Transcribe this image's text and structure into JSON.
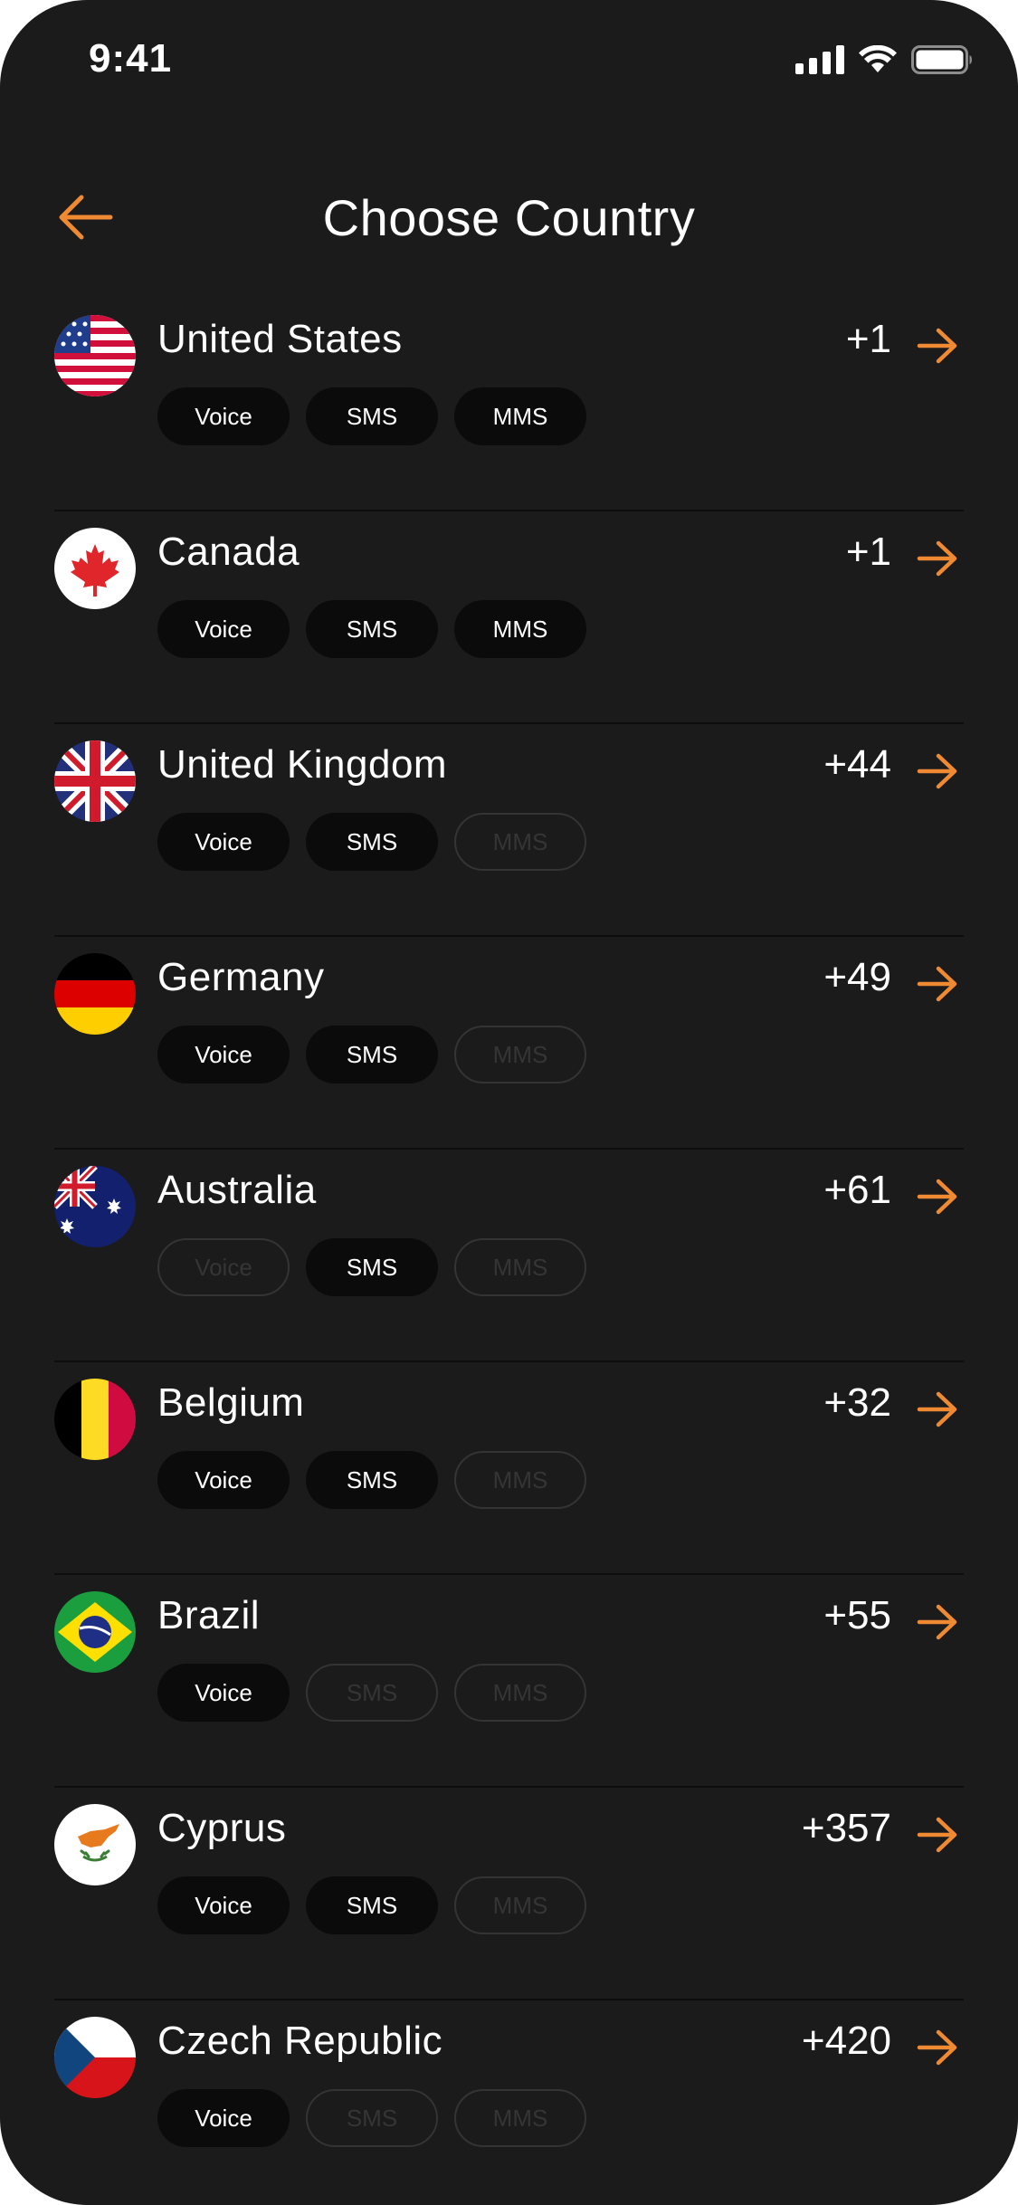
{
  "status": {
    "time": "9:41"
  },
  "header": {
    "title": "Choose Country"
  },
  "colors": {
    "accent": "#f08a32",
    "background": "#1b1b1c",
    "chip_on": "#0b0b0b"
  },
  "countries": [
    {
      "name": "United States",
      "code": "+1",
      "flag": "us-flag-icon",
      "services": [
        {
          "label": "Voice",
          "available": true
        },
        {
          "label": "SMS",
          "available": true
        },
        {
          "label": "MMS",
          "available": true
        }
      ]
    },
    {
      "name": "Canada",
      "code": "+1",
      "flag": "canada-flag-icon",
      "services": [
        {
          "label": "Voice",
          "available": true
        },
        {
          "label": "SMS",
          "available": true
        },
        {
          "label": "MMS",
          "available": true
        }
      ]
    },
    {
      "name": "United Kingdom",
      "code": "+44",
      "flag": "uk-flag-icon",
      "services": [
        {
          "label": "Voice",
          "available": true
        },
        {
          "label": "SMS",
          "available": true
        },
        {
          "label": "MMS",
          "available": false
        }
      ]
    },
    {
      "name": "Germany",
      "code": "+49",
      "flag": "germany-flag-icon",
      "services": [
        {
          "label": "Voice",
          "available": true
        },
        {
          "label": "SMS",
          "available": true
        },
        {
          "label": "MMS",
          "available": false
        }
      ]
    },
    {
      "name": "Australia",
      "code": "+61",
      "flag": "australia-flag-icon",
      "services": [
        {
          "label": "Voice",
          "available": false
        },
        {
          "label": "SMS",
          "available": true
        },
        {
          "label": "MMS",
          "available": false
        }
      ]
    },
    {
      "name": "Belgium",
      "code": "+32",
      "flag": "belgium-flag-icon",
      "services": [
        {
          "label": "Voice",
          "available": true
        },
        {
          "label": "SMS",
          "available": true
        },
        {
          "label": "MMS",
          "available": false
        }
      ]
    },
    {
      "name": "Brazil",
      "code": "+55",
      "flag": "brazil-flag-icon",
      "services": [
        {
          "label": "Voice",
          "available": true
        },
        {
          "label": "SMS",
          "available": false
        },
        {
          "label": "MMS",
          "available": false
        }
      ]
    },
    {
      "name": "Cyprus",
      "code": "+357",
      "flag": "cyprus-flag-icon",
      "services": [
        {
          "label": "Voice",
          "available": true
        },
        {
          "label": "SMS",
          "available": true
        },
        {
          "label": "MMS",
          "available": false
        }
      ]
    },
    {
      "name": "Czech Republic",
      "code": "+420",
      "flag": "czech-flag-icon",
      "services": [
        {
          "label": "Voice",
          "available": true
        },
        {
          "label": "SMS",
          "available": false
        },
        {
          "label": "MMS",
          "available": false
        }
      ]
    }
  ]
}
